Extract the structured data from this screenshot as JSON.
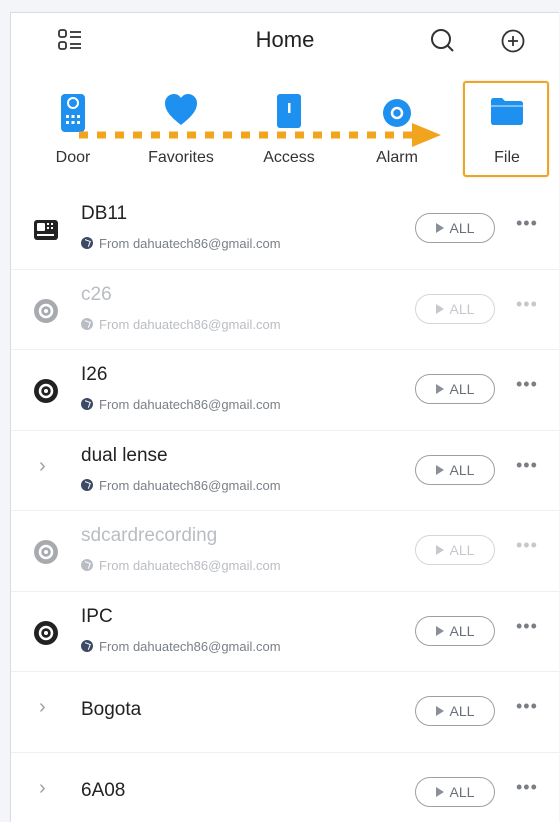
{
  "header": {
    "title": "Home"
  },
  "categories": [
    {
      "label": "Door",
      "icon": "door-icon"
    },
    {
      "label": "Favorites",
      "icon": "favorites-heart-icon"
    },
    {
      "label": "Access",
      "icon": "access-icon"
    },
    {
      "label": "Alarm",
      "icon": "alarm-icon"
    },
    {
      "label": "File",
      "icon": "folder-icon"
    }
  ],
  "colors": {
    "accent": "#1e90f0",
    "highlight": "#f1a41d"
  },
  "devices": [
    {
      "name": "DB11",
      "from": "From dahuatech86@gmail.com",
      "all": "ALL",
      "icon": "doorbell-icon",
      "dimmed": false
    },
    {
      "name": "c26",
      "from": "From dahuatech86@gmail.com",
      "all": "ALL",
      "icon": "camera-icon",
      "dimmed": true
    },
    {
      "name": "I26",
      "from": "From dahuatech86@gmail.com",
      "all": "ALL",
      "icon": "camera-icon",
      "dimmed": false
    },
    {
      "name": "dual lense",
      "from": "From dahuatech86@gmail.com",
      "all": "ALL",
      "icon": "chevron-right-icon",
      "dimmed": false
    },
    {
      "name": "sdcardrecording",
      "from": "From dahuatech86@gmail.com",
      "all": "ALL",
      "icon": "camera-icon",
      "dimmed": true
    },
    {
      "name": "IPC",
      "from": "From dahuatech86@gmail.com",
      "all": "ALL",
      "icon": "camera-icon",
      "dimmed": false
    },
    {
      "name": "Bogota",
      "from": "",
      "all": "ALL",
      "icon": "chevron-right-icon",
      "dimmed": false
    },
    {
      "name": "6A08",
      "from": "",
      "all": "ALL",
      "icon": "chevron-right-icon",
      "dimmed": false
    }
  ]
}
